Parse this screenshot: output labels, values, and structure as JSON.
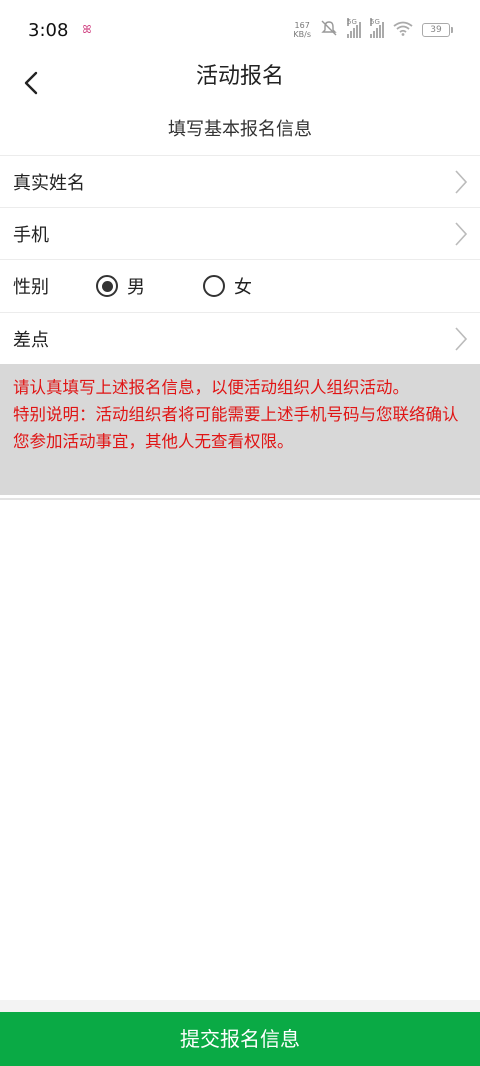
{
  "status_bar": {
    "time": "3:08",
    "notification_glyph": "ꕤ",
    "net_speed_value": "167",
    "net_speed_unit": "KB/s",
    "signal_1_tag": "5G",
    "signal_2_tag": "5G",
    "battery": "39"
  },
  "nav": {
    "title": "活动报名"
  },
  "section_title": "填写基本报名信息",
  "form": {
    "name_label": "真实姓名",
    "phone_label": "手机",
    "gender_label": "性别",
    "gender_options": [
      "男",
      "女"
    ],
    "gender_selected": "男",
    "diff_label": "差点"
  },
  "notice": {
    "line1": "请认真填写上述报名信息，以便活动组织人组织活动。",
    "line2": "特别说明：活动组织者将可能需要上述手机号码与您联络确认您参加活动事宜，其他人无查看权限。"
  },
  "submit_label": "提交报名信息",
  "colors": {
    "accent_green": "#0aaa45",
    "notice_red": "#e01414",
    "notice_bg": "#d8d8d8"
  }
}
